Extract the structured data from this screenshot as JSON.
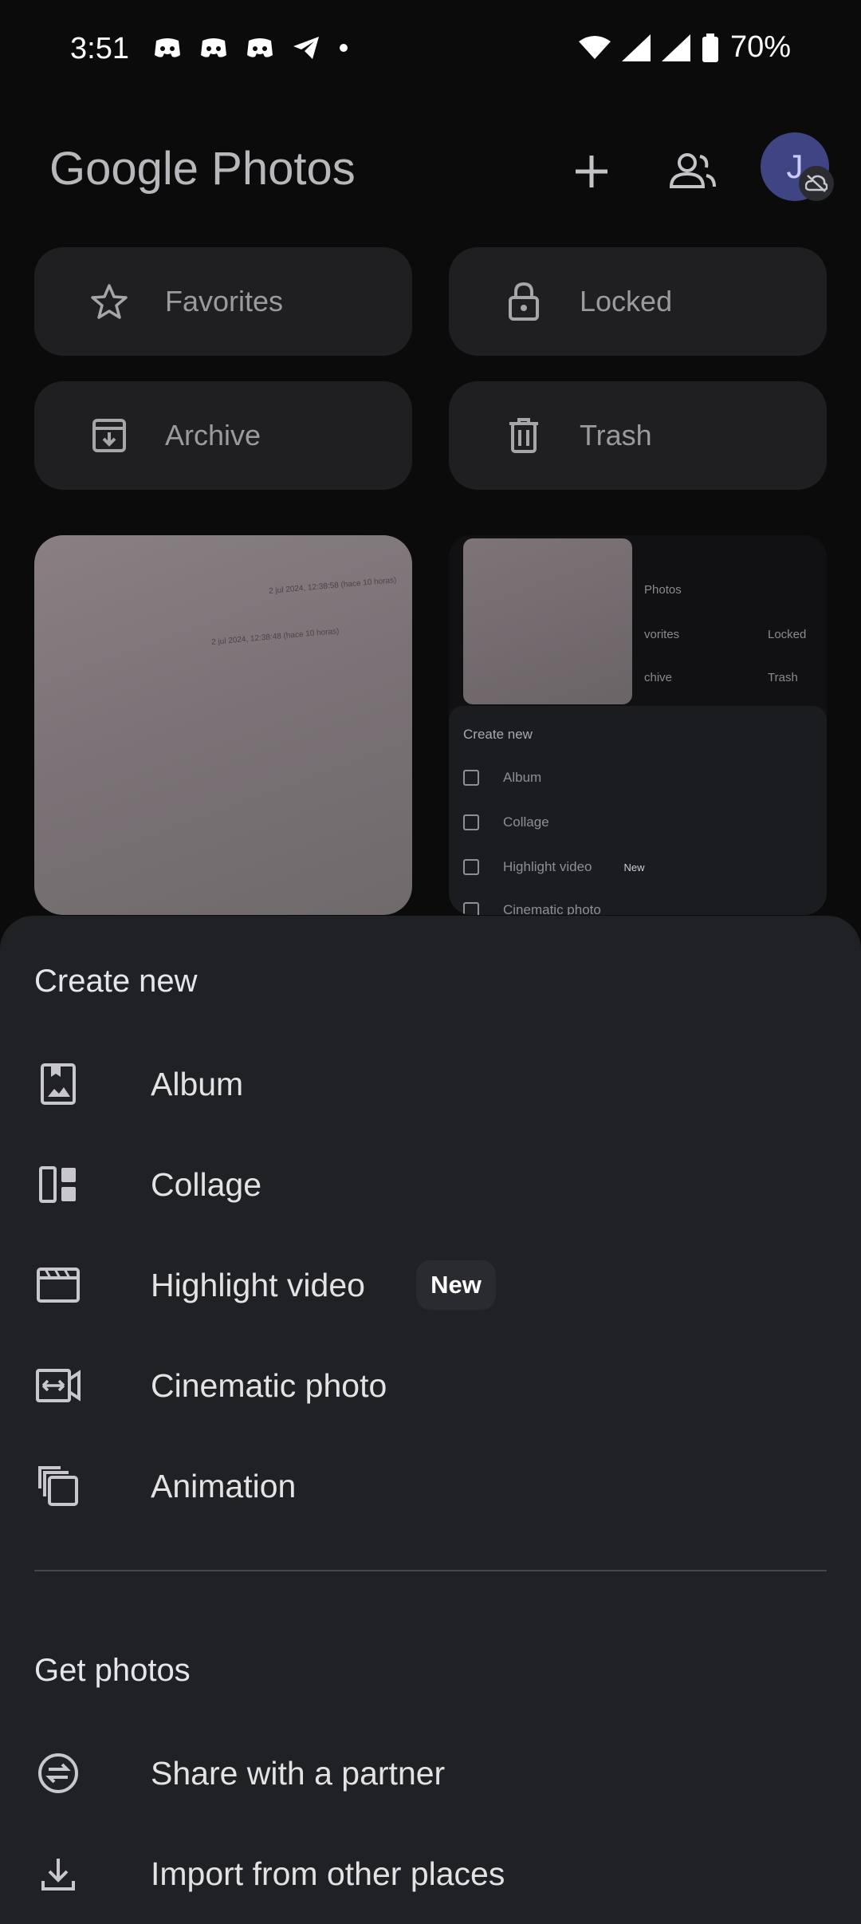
{
  "status_bar": {
    "time": "3:51",
    "battery": "70%"
  },
  "top_bar": {
    "logo_google": "Google",
    "logo_photos": "Photos",
    "avatar_initial": "J"
  },
  "tiles": [
    {
      "label": "Favorites",
      "icon": "star-icon"
    },
    {
      "label": "Locked",
      "icon": "lock-icon"
    },
    {
      "label": "Archive",
      "icon": "archive-icon"
    },
    {
      "label": "Trash",
      "icon": "trash-icon"
    }
  ],
  "thumbnails": {
    "photo1_caption_a": "2 jul 2024, 12:38:58 (hace 10 horas)",
    "photo1_caption_b": "2 jul 2024, 12:38:48 (hace 10 horas)",
    "mini_header": "Photos",
    "mini_tiles": [
      "vorites",
      "Locked",
      "chive",
      "Trash"
    ],
    "mini_sheet_title": "Create new",
    "mini_items": [
      "Album",
      "Collage",
      "Highlight video",
      "Cinematic photo"
    ],
    "mini_new": "New"
  },
  "sheet": {
    "create_title": "Create new",
    "create_items": [
      {
        "label": "Album",
        "icon": "album-icon"
      },
      {
        "label": "Collage",
        "icon": "collage-icon"
      },
      {
        "label": "Highlight video",
        "icon": "highlight-video-icon",
        "badge": "New"
      },
      {
        "label": "Cinematic photo",
        "icon": "cinematic-photo-icon"
      },
      {
        "label": "Animation",
        "icon": "animation-icon"
      }
    ],
    "get_title": "Get photos",
    "get_items": [
      {
        "label": "Share with a partner",
        "icon": "partner-share-icon"
      },
      {
        "label": "Import from other places",
        "icon": "download-icon"
      }
    ]
  },
  "colors": {
    "background": "#0b0b0c",
    "sheet": "#202125",
    "tile": "#1f1f22",
    "avatar": "#3e4582"
  }
}
